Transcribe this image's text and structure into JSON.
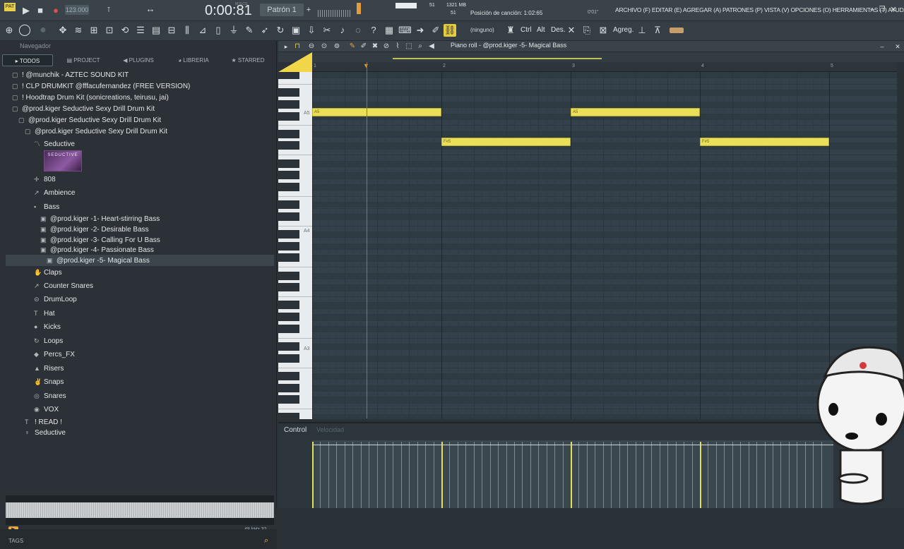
{
  "transport": {
    "tempo": "123.000",
    "time": "0:00:81",
    "time_unit": "M:S:CS",
    "pattern": "Patrón 1",
    "cpu": "51",
    "ram": "1321 MB",
    "voices": "51",
    "hint": "Posición de canción: 1:02:65",
    "hint_extra": "0'01\""
  },
  "menu": "ARCHIVO (F) EDITAR (E) AGREGAR (A) PATRONES (P) VISTA (V) OPCIONES (O) HERRAMIENTAS (T) AYUDA",
  "toolbar": {
    "preset": "(ninguno)",
    "ctrl": "Ctrl",
    "alt": "Alt",
    "des": "Des.",
    "agreg": "Agreg."
  },
  "browser": {
    "title": "Navegador",
    "tabs": [
      "TODOS",
      "PROJECT",
      "PLUGINS",
      "LIBRERIA",
      "STARRED"
    ],
    "items": [
      {
        "label": "! @munchik - AZTEC SOUND KIT",
        "indent": 1,
        "glyph": "▢"
      },
      {
        "label": "! CLP DRUMKIT @fffacufernandez (FREE VERSION)",
        "indent": 1,
        "glyph": "▢"
      },
      {
        "label": "! Hoodtrap Drum Kit (sonicreations, teirusu, jai)",
        "indent": 1,
        "glyph": "▢"
      },
      {
        "label": "@prod.kiger Seductive Sexy Drill Drum Kit",
        "indent": 1,
        "glyph": "▢"
      },
      {
        "label": "@prod.kiger Seductive Sexy Drill Drum Kit",
        "indent": 2,
        "glyph": "▢"
      },
      {
        "label": "@prod.kiger Seductive Sexy Drill Drum Kit",
        "indent": 3,
        "glyph": "▢"
      },
      {
        "label": "Seductive",
        "indent": 4,
        "glyph": "〽"
      },
      {
        "label": "808",
        "indent": 4,
        "glyph": "✛"
      },
      {
        "label": "Ambience",
        "indent": 4,
        "glyph": "↗"
      },
      {
        "label": "Bass",
        "indent": 4,
        "glyph": "▪"
      },
      {
        "label": "@prod.kiger -1- Heart-stirring Bass",
        "indent": 5,
        "glyph": "▣"
      },
      {
        "label": "@prod.kiger -2- Desirable Bass",
        "indent": 5,
        "glyph": "▣"
      },
      {
        "label": "@prod.kiger -3- Calling For U Bass",
        "indent": 5,
        "glyph": "▣"
      },
      {
        "label": "@prod.kiger -4- Passionate Bass",
        "indent": 5,
        "glyph": "▣"
      },
      {
        "label": "@prod.kiger -5- Magical Bass",
        "indent": 6,
        "glyph": "▣"
      },
      {
        "label": "Claps",
        "indent": 4,
        "glyph": "✋"
      },
      {
        "label": "Counter Snares",
        "indent": 4,
        "glyph": "↗"
      },
      {
        "label": "DrumLoop",
        "indent": 4,
        "glyph": "⊝"
      },
      {
        "label": "Hat",
        "indent": 4,
        "glyph": "T"
      },
      {
        "label": "Kicks",
        "indent": 4,
        "glyph": "●"
      },
      {
        "label": "Loops",
        "indent": 4,
        "glyph": "↻"
      },
      {
        "label": "Percs_FX",
        "indent": 4,
        "glyph": "◆"
      },
      {
        "label": "Risers",
        "indent": 4,
        "glyph": "▲"
      },
      {
        "label": "Snaps",
        "indent": 4,
        "glyph": "✌"
      },
      {
        "label": "Snares",
        "indent": 4,
        "glyph": "◎"
      },
      {
        "label": "VOX",
        "indent": 4,
        "glyph": "◉"
      },
      {
        "label": "! READ !",
        "indent": 3,
        "glyph": "T"
      },
      {
        "label": "Seductive",
        "indent": 3,
        "glyph": "♆"
      }
    ],
    "thumb_text": "SEDUCTIVE",
    "sample_info": "48 kHz 32",
    "tags": "TAGS"
  },
  "piano_roll": {
    "title": "Piano roll - @prod.kiger -5- Magical Bass",
    "bars": [
      "1",
      "2",
      "3",
      "4",
      "5"
    ],
    "key_labels": [
      "A5",
      "A4",
      "A3"
    ],
    "control_label": "Control",
    "control_value": "Velocidad",
    "notes": [
      {
        "pitch": "A5",
        "start": 1.0,
        "length": 1.0
      },
      {
        "pitch": "F#5",
        "start": 2.0,
        "length": 1.0
      },
      {
        "pitch": "A5",
        "start": 3.0,
        "length": 1.0
      },
      {
        "pitch": "F#5",
        "start": 4.0,
        "length": 1.0
      }
    ]
  },
  "colors": {
    "note": "#e9df59",
    "accent": "#f1d64a",
    "grid": "#34414a"
  }
}
